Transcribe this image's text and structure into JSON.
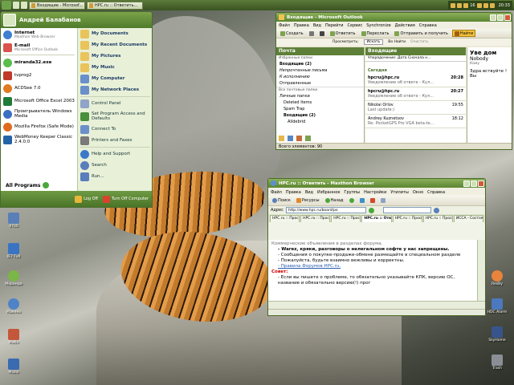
{
  "taskbar": {
    "tasks": [
      "Входящие - Microsof...",
      "HPC.ru :: Ответить..."
    ],
    "tray_count": "16",
    "clock": "20:33"
  },
  "start_menu": {
    "user_name": "Андрей Балабанов",
    "pinned": [
      {
        "title": "Internet",
        "subtitle": "Maxthon Web Browser",
        "icon": "globe-icon",
        "color": "#3f7fd0"
      },
      {
        "title": "E-mail",
        "subtitle": "Microsoft Office Outlook",
        "icon": "mail-icon",
        "color": "#d9534f"
      }
    ],
    "recent": [
      {
        "title": "miranda32.exe",
        "icon": "miranda-icon",
        "color": "#5bbd4a"
      },
      {
        "title": "tvprog2",
        "icon": "tv-icon",
        "color": "#c0392b"
      },
      {
        "title": "ACDSee 7.0",
        "icon": "acdsee-icon",
        "color": "#e07b22"
      },
      {
        "title": "Microsoft Office Excel 2003",
        "icon": "excel-icon",
        "color": "#1f7a3a"
      },
      {
        "title": "Проигрыватель Windows Media",
        "icon": "media-player-icon",
        "color": "#3b6fc4"
      },
      {
        "title": "Mozilla Firefox (Safe Mode)",
        "icon": "firefox-icon",
        "color": "#e06b1f"
      },
      {
        "title": "WebMoney Keeper Classic 2.4.0.0",
        "icon": "webmoney-icon",
        "color": "#2563a8"
      }
    ],
    "all_programs": "All Programs",
    "right_top": [
      {
        "label": "My Documents",
        "icon": "folder-icon",
        "color": "#e9c45a"
      },
      {
        "label": "My Recent Documents",
        "icon": "recent-docs-icon",
        "color": "#e9c45a"
      },
      {
        "label": "My Pictures",
        "icon": "pictures-icon",
        "color": "#e9c45a"
      },
      {
        "label": "My Music",
        "icon": "music-icon",
        "color": "#e9c45a"
      },
      {
        "label": "My Computer",
        "icon": "computer-icon",
        "color": "#6b8fc9"
      },
      {
        "label": "My Network Places",
        "icon": "network-icon",
        "color": "#6b8fc9"
      }
    ],
    "right_bottom": [
      {
        "label": "Control Panel",
        "icon": "control-panel-icon",
        "color": "#8fa4c8"
      },
      {
        "label": "Set Program Access and Defaults",
        "icon": "program-access-icon",
        "color": "#4a8f3c"
      },
      {
        "label": "Connect To",
        "icon": "connect-icon",
        "color": "#6b8fc9"
      },
      {
        "label": "Printers and Faxes",
        "icon": "printer-icon",
        "color": "#7a7a7a"
      },
      {
        "label": "Help and Support",
        "icon": "help-icon",
        "color": "#3a79c9"
      },
      {
        "label": "Search",
        "icon": "search-icon",
        "color": "#5a7dbb"
      },
      {
        "label": "Run...",
        "icon": "run-icon",
        "color": "#5a7dbb"
      }
    ],
    "log_off": "Log Off",
    "turn_off": "Turn Off Computer"
  },
  "outlook": {
    "title": "Входящие - Microsoft Outlook",
    "menu": [
      "Файл",
      "Правка",
      "Вид",
      "Перейти",
      "Сервис",
      "Synchronize",
      "Действия",
      "Справка"
    ],
    "toolbar": [
      "Создать",
      "Ответить",
      "Переслать",
      "Отправить и получить",
      "Найти"
    ],
    "nav_header": "Почта",
    "favorites_label": "Избранные папки",
    "favorites": [
      "Входящие (2)",
      "Непрочтенные письма",
      "К исполнению",
      "Отправленные"
    ],
    "all_folders_label": "Все почтовые папки",
    "folders": [
      "Личные папки",
      "Deleted Items",
      "Spam Trap",
      "Входящие (2)",
      "Alldebrid"
    ],
    "statusbar": "Всего элементов: 90",
    "inbox_header": "Входящие",
    "sort_text": "Упорядочение: Дата   Сначала н...",
    "today_label": "Сегодня",
    "mails": [
      {
        "from": "hpcru@hpc.ru",
        "time": "20:28",
        "subject": "Уведомление об ответе - Кул..."
      },
      {
        "from": "hpcru@hpc.ru",
        "time": "20:27",
        "subject": "Уведомление об ответе - Кул..."
      },
      {
        "from": "Nikolai Orlov",
        "time": "19:55",
        "subject": "Last update:)"
      },
      {
        "from": "Andrey Kuznetsov",
        "time": "18:12",
        "subject": "Re: PocketGPS Pro VGA beta-te..."
      }
    ],
    "search_bar": {
      "label": "Просмотреть:",
      "search": "Искать",
      "in": "Во Найти",
      "clear": "Очистить"
    },
    "reading_pane": {
      "from": "Уве дом",
      "to": "Nobody",
      "field": "Кому",
      "body": "Здра вствуйте !  Вы"
    }
  },
  "maxthon": {
    "title": "HPC.ru :: Ответить - Maxthon Browser",
    "menu": [
      "Файл",
      "Правка",
      "Вид",
      "Избранное",
      "Группы",
      "Настройки",
      "Утилиты",
      "Окно",
      "Справка"
    ],
    "toolbar": [
      "Поиск",
      "Ресурсы",
      "Назад"
    ],
    "address_label": "Адрес",
    "address": "http://www.hpc.ru/board/po",
    "tabs": [
      "HPC.ru :: Просмо",
      "HPC.ru :: Просмо",
      "HPC.ru :: Просмо",
      "HPC.ru :: Отв",
      "HPC.ru :: Просмо",
      "HPC.ru :: Просмо",
      "ИССА - Состояни"
    ],
    "content": {
      "line1": "Коммерческие объявления в разделах форума.",
      "item1": "- Warez, кряки, разговоры о нелегальном софте у нас запрещены.",
      "item2": "- Сообщения о покупке-продаже-обмене размещайте в специальном разделе",
      "item3": "- Пожалуйста, будьте взаимно вежливы и корректны.",
      "item4": "- Правила Форумов HPC.ru.",
      "advice": "Совет:",
      "item5": "- Если вы пишете о проблеме, то обязательно указывайте КПК, версию ОС, название и обязательно версию(!) прог"
    }
  },
  "desktop_icons": [
    {
      "label": "4700",
      "color": "#5a7fb8"
    },
    {
      "label": "IE7 Full",
      "color": "#3b73c4"
    },
    {
      "label": "Миранда",
      "color": "#7ab648"
    },
    {
      "label": "Маклео",
      "color": "#4f83c7"
    },
    {
      "label": "Мобл",
      "color": "#c4573b"
    },
    {
      "label": "Mozlo",
      "color": "#3a6ab0"
    },
    {
      "label": "ResBy",
      "color": "#e8843c"
    },
    {
      "label": "HDC Alarm",
      "color": "#4a79bd"
    },
    {
      "label": "SkyHome",
      "color": "#37548d"
    },
    {
      "label": "Trash",
      "color": "#8a8f96"
    }
  ]
}
